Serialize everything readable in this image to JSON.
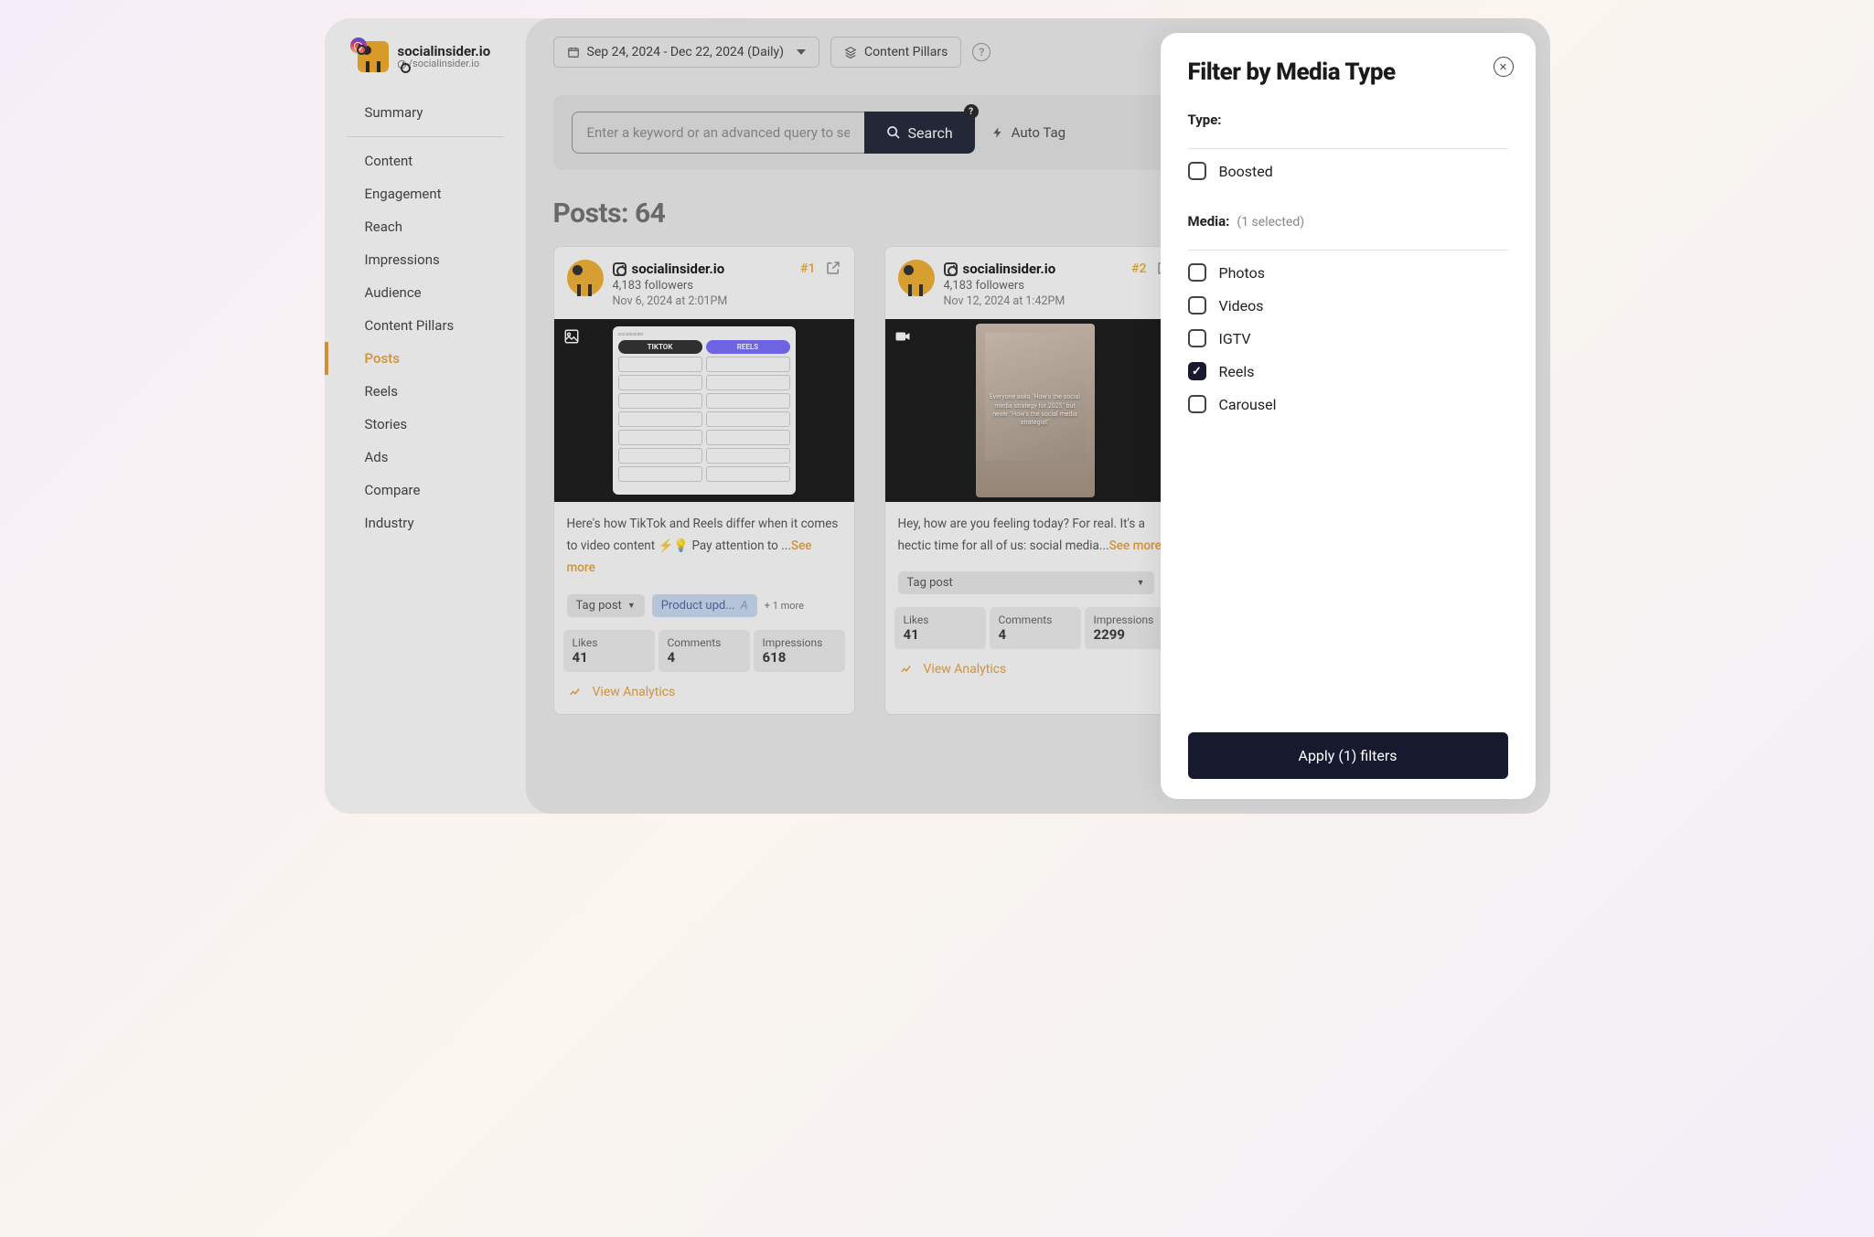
{
  "brand": {
    "title": "socialinsider.io",
    "handle": "/socialinsider.io"
  },
  "sidebar": {
    "items": [
      {
        "label": "Summary"
      },
      {
        "label": "Content"
      },
      {
        "label": "Engagement"
      },
      {
        "label": "Reach"
      },
      {
        "label": "Impressions"
      },
      {
        "label": "Audience"
      },
      {
        "label": "Content Pillars"
      },
      {
        "label": "Posts"
      },
      {
        "label": "Reels"
      },
      {
        "label": "Stories"
      },
      {
        "label": "Ads"
      },
      {
        "label": "Compare"
      },
      {
        "label": "Industry"
      }
    ],
    "active_index": 7
  },
  "topbar": {
    "date_range": "Sep 24, 2024 - Dec 22, 2024 (Daily)",
    "content_pillars": "Content Pillars"
  },
  "search": {
    "placeholder": "Enter a keyword or an advanced query to sea",
    "button": "Search",
    "auto_tag": "Auto Tag"
  },
  "posts_heading_prefix": "Posts: ",
  "posts_count": "64",
  "cards": [
    {
      "name": "socialinsider.io",
      "followers": "4,183 followers",
      "date": "Nov 6, 2024 at 2:01PM",
      "rank": "#1",
      "caption_a": "Here's how TikTok and Reels differ when it comes to video content ⚡💡 Pay attention to ...",
      "see_more": "See more",
      "tag_label": "Tag post",
      "chip": "Product upd...",
      "more": "+ 1 more",
      "stats": {
        "likes_label": "Likes",
        "likes": "41",
        "comments_label": "Comments",
        "comments": "4",
        "impressions_label": "Impressions",
        "impressions": "618"
      },
      "view": "View Analytics"
    },
    {
      "name": "socialinsider.io",
      "followers": "4,183 followers",
      "date": "Nov 12, 2024 at 1:42PM",
      "rank": "#2",
      "caption_a": "Hey, how are you feeling today? For real. It's a hectic time for all of us: social media...",
      "see_more": "See more",
      "tag_label": "Tag post",
      "stats": {
        "likes_label": "Likes",
        "likes": "41",
        "comments_label": "Comments",
        "comments": "4",
        "impressions_label": "Impressions",
        "impressions": "2299"
      },
      "view": "View Analytics"
    }
  ],
  "reel_overlay_text": "Everyone asks \"How's the social media strategy for 2025\" but never \"How's the social media strategist\"",
  "panel": {
    "title": "Filter by Media Type",
    "type_label": "Type:",
    "media_label": "Media:",
    "media_selected": "(1 selected)",
    "options_type": [
      {
        "label": "Boosted",
        "checked": false
      }
    ],
    "options_media": [
      {
        "label": "Photos",
        "checked": false
      },
      {
        "label": "Videos",
        "checked": false
      },
      {
        "label": "IGTV",
        "checked": false
      },
      {
        "label": "Reels",
        "checked": true
      },
      {
        "label": "Carousel",
        "checked": false
      }
    ],
    "apply": "Apply  (1)  filters"
  }
}
